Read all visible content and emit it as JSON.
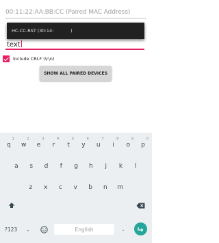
{
  "mac_field": {
    "placeholder": "00:11:22:AA:BB:CC (Paired MAC Address)"
  },
  "dropdown": {
    "item_text": "HC-CC-RST (30:14:            )"
  },
  "text_field": {
    "value": "text"
  },
  "crlf": {
    "checked": true,
    "label": "Include CRLF (\\r\\n)"
  },
  "show_button": {
    "label": "SHOW ALL PAIRED DEVICES"
  },
  "keyboard": {
    "row1": [
      "q",
      "w",
      "e",
      "r",
      "t",
      "y",
      "u",
      "i",
      "o",
      "p"
    ],
    "row1_hints": [
      "1",
      "2",
      "3",
      "4",
      "5",
      "6",
      "7",
      "8",
      "9",
      "0"
    ],
    "row2": [
      "a",
      "s",
      "d",
      "f",
      "g",
      "h",
      "j",
      "k",
      "l"
    ],
    "row3": [
      "z",
      "x",
      "c",
      "v",
      "b",
      "n",
      "m"
    ],
    "symbols_label": "?123",
    "comma_label": ",",
    "period_label": ".",
    "space_label": "English",
    "shift_icon": "shift-icon",
    "backspace_icon": "backspace-icon",
    "emoji_icon": "emoji-icon",
    "enter_icon": "enter-icon",
    "accent_color": "#e91e63",
    "enter_color": "#26a69a"
  }
}
